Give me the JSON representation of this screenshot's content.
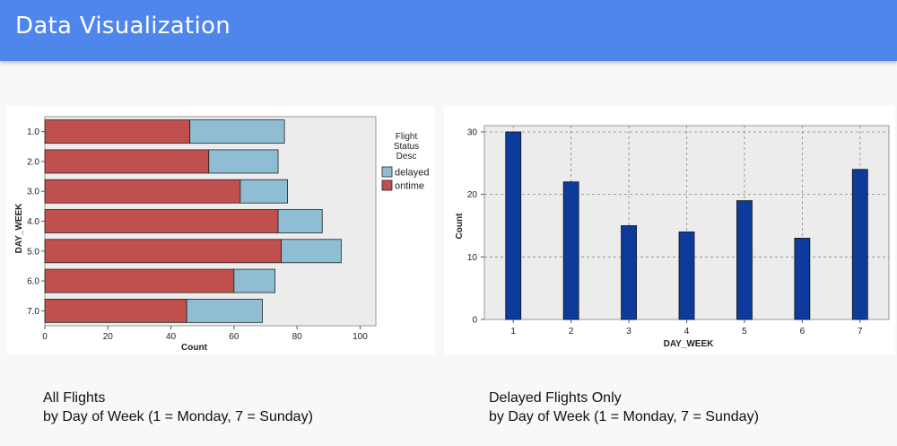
{
  "header": {
    "title": "Data Visualization"
  },
  "colors": {
    "header_bg": "#4f86ec",
    "delayed": "#8fbdd3",
    "ontime": "#c0504d",
    "bar_blue": "#0c3b9c",
    "plot_bg": "#ececec"
  },
  "chart_data": [
    {
      "type": "bar",
      "orientation": "horizontal",
      "stacked": true,
      "categories": [
        "1.0",
        "2.0",
        "3.0",
        "4.0",
        "5.0",
        "6.0",
        "7.0"
      ],
      "series": [
        {
          "name": "ontime",
          "values": [
            46,
            52,
            62,
            74,
            75,
            60,
            45
          ]
        },
        {
          "name": "delayed",
          "values": [
            30,
            22,
            15,
            14,
            19,
            13,
            24
          ]
        }
      ],
      "xlabel": "Count",
      "ylabel": "DAY_WEEK",
      "xlim": [
        0,
        105
      ],
      "xticks": [
        0,
        20,
        40,
        60,
        80,
        100
      ],
      "legend": {
        "title": "Flight Status Desc",
        "title_lines": [
          "Flight",
          "Status",
          "Desc"
        ],
        "entries": [
          "delayed",
          "ontime"
        ],
        "placement": "right"
      },
      "grid": false
    },
    {
      "type": "bar",
      "categories": [
        "1",
        "2",
        "3",
        "4",
        "5",
        "6",
        "7"
      ],
      "values": [
        30,
        22,
        15,
        14,
        19,
        13,
        24
      ],
      "xlabel": "DAY_WEEK",
      "ylabel": "Count",
      "ylim": [
        0,
        31
      ],
      "yticks": [
        0,
        10,
        20,
        30
      ],
      "grid": true
    }
  ],
  "captions": [
    {
      "line1": "All Flights",
      "line2": "by Day of Week (1 = Monday, 7 = Sunday)"
    },
    {
      "line1": "Delayed Flights Only",
      "line2": "by Day of Week (1 = Monday, 7 = Sunday)"
    }
  ]
}
